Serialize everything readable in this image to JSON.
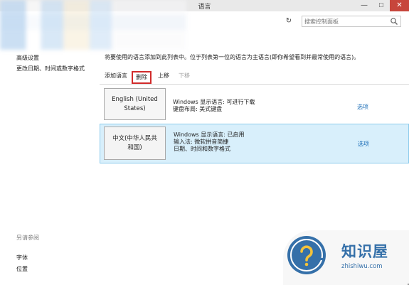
{
  "window": {
    "title": "语言",
    "minimize_glyph": "—",
    "maximize_glyph": "☐",
    "close_glyph": "✕"
  },
  "address_bar": {
    "refresh_glyph": "↻",
    "search_placeholder": "搜索控制面板",
    "search_icon": "search-icon"
  },
  "sidebar": {
    "advanced_settings": "高级设置",
    "change_datetime": "更改日期、时间或数字格式",
    "see_also": "另请参阅",
    "font": "字体",
    "location": "位置"
  },
  "main": {
    "instruction": "将要使用的语言添加到此列表中。位于列表第一位的语言为主语言(即你希望看到并最常使用的语言)。",
    "toolbar": {
      "add": "添加语言",
      "remove": "删除",
      "move_up": "上移",
      "move_down": "下移"
    },
    "languages": [
      {
        "name_line1": "English (United",
        "name_line2": "States)",
        "info_line1": "Windows 显示语言: 可进行下载",
        "info_line2": "键盘布局: 美式键盘",
        "info_line3": "",
        "options": "选项"
      },
      {
        "name_line1": "中文(中华人民共",
        "name_line2": "和国)",
        "info_line1": "Windows 显示语言: 已启用",
        "info_line2": "输入法: 微软拼音简捷",
        "info_line3": "日期、时间和数字格式",
        "options": "选项"
      }
    ]
  },
  "watermark": {
    "title": "知识屋",
    "url": "zhishiwu.com"
  },
  "colors": {
    "selected_row": "#d8effb",
    "selected_border": "#8ccbec",
    "highlight_border": "#d12a2a",
    "link": "#1e6fb8",
    "watermark": "#3570a9",
    "close_button": "#c7463c"
  }
}
